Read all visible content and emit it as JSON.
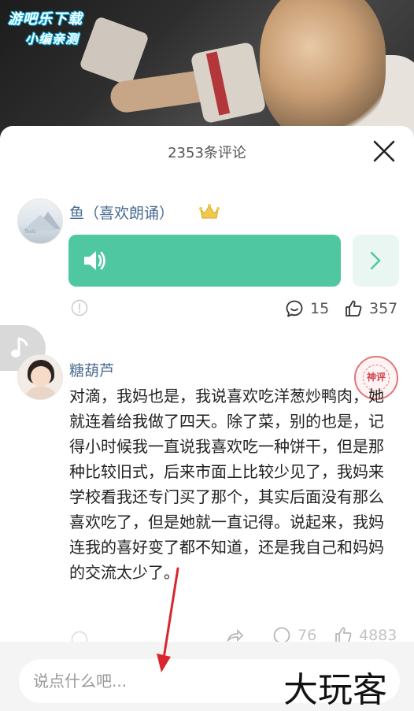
{
  "hero": {
    "watermark_line1": "游吧乐下载",
    "watermark_line2": "小编亲测"
  },
  "sheet": {
    "comment_count": "2353条评论"
  },
  "comments": [
    {
      "username": "鱼（喜欢朗诵）",
      "avatar_text": "Tools",
      "has_crown": true,
      "voice": true,
      "reply_count": "15",
      "like_count": "357"
    },
    {
      "username": "糖葫芦",
      "seal_text": "神评",
      "body": "对滴，我妈也是，我说喜欢吃洋葱炒鸭肉，她就连着给我做了四天。除了菜，别的也是，记得小时候我一直说我喜欢吃一种饼干，但是那种比较旧式，后来市面上比较少见了，我妈来学校看我还专门买了那个，其实后面没有那么喜欢吃了，但是她就一直记得。说起来，我妈连我的喜好变了都不知道，还是我自己和妈妈的交流太少了。",
      "reply_count": "76",
      "like_count": "4883"
    }
  ],
  "input": {
    "placeholder": "说点什么吧..."
  },
  "watermark_br": "大玩客",
  "colors": {
    "voice_green": "#4fc7a0",
    "username_blue": "#4a6c93",
    "arrow_red": "#d9262c"
  }
}
